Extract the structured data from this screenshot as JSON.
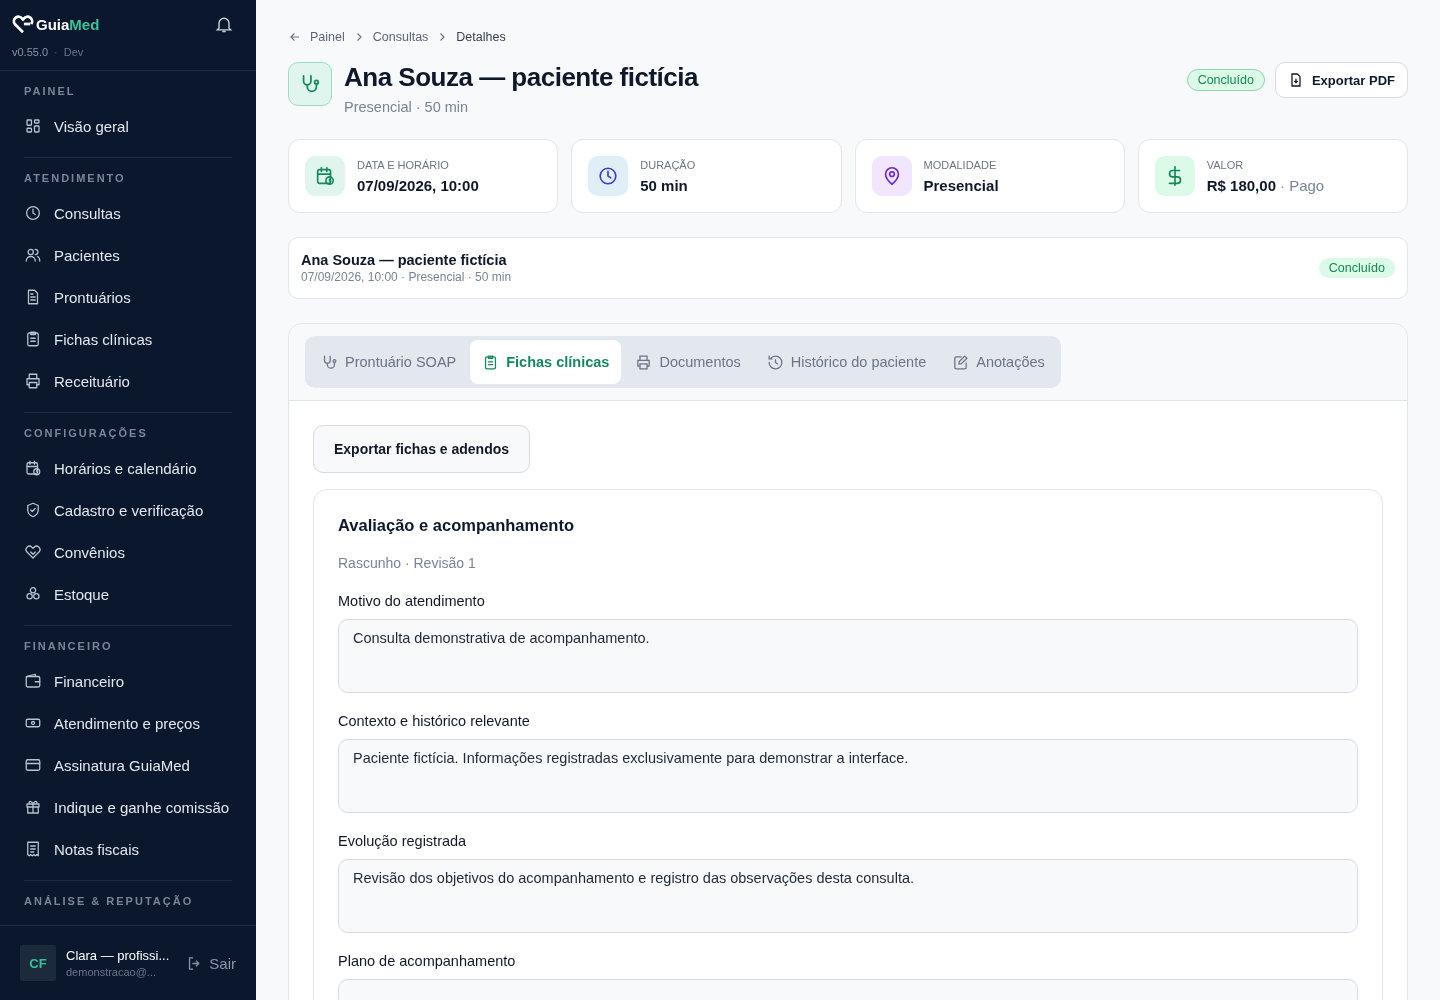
{
  "brand": {
    "name_part1": "Guia",
    "name_part2": "Med",
    "version": "v0.55.0",
    "separator": "·",
    "env": "Dev"
  },
  "sidebar": {
    "sections": [
      {
        "title": "PAINEL",
        "items": [
          {
            "label": "Visão geral"
          }
        ]
      },
      {
        "title": "ATENDIMENTO",
        "items": [
          {
            "label": "Consultas"
          },
          {
            "label": "Pacientes"
          },
          {
            "label": "Prontuários"
          },
          {
            "label": "Fichas clínicas"
          },
          {
            "label": "Receituário"
          }
        ]
      },
      {
        "title": "CONFIGURAÇÕES",
        "items": [
          {
            "label": "Horários e calendário"
          },
          {
            "label": "Cadastro e verificação"
          },
          {
            "label": "Convênios"
          },
          {
            "label": "Estoque"
          }
        ]
      },
      {
        "title": "FINANCEIRO",
        "items": [
          {
            "label": "Financeiro"
          },
          {
            "label": "Atendimento e preços"
          },
          {
            "label": "Assinatura GuiaMed"
          },
          {
            "label": "Indique e ganhe comissão"
          },
          {
            "label": "Notas fiscais"
          }
        ]
      },
      {
        "title": "ANÁLISE & REPUTAÇÃO"
      }
    ],
    "user": {
      "initials": "CF",
      "name": "Clara — profissi...",
      "email": "demonstracao@...",
      "logout": "Sair"
    }
  },
  "breadcrumb": [
    "Painel",
    "Consultas",
    "Detalhes"
  ],
  "header": {
    "title": "Ana Souza — paciente fictícia",
    "subtitle": "Presencial · 50 min",
    "status": "Concluído",
    "export": "Exportar PDF"
  },
  "stats": [
    {
      "label": "DATA E HORÁRIO",
      "value": "07/09/2026, 10:00"
    },
    {
      "label": "DURAÇÃO",
      "value": "50 min"
    },
    {
      "label": "MODALIDADE",
      "value": "Presencial"
    },
    {
      "label": "VALOR",
      "value": "R$ 180,00",
      "note": "· Pago"
    }
  ],
  "summary": {
    "title": "Ana Souza — paciente fictícia",
    "meta": "07/09/2026, 10:00 · Presencial · 50 min",
    "status": "Concluído"
  },
  "tabs": [
    {
      "label": "Prontuário SOAP",
      "selected": false
    },
    {
      "label": "Fichas clínicas",
      "selected": true
    },
    {
      "label": "Documentos",
      "selected": false
    },
    {
      "label": "Histórico do paciente",
      "selected": false
    },
    {
      "label": "Anotações",
      "selected": false
    }
  ],
  "export_button": "Exportar fichas e adendos",
  "form": {
    "title": "Avaliação e acompanhamento",
    "meta": "Rascunho · Revisão 1",
    "fields": [
      {
        "label": "Motivo do atendimento",
        "value": "Consulta demonstrativa de acompanhamento."
      },
      {
        "label": "Contexto e histórico relevante",
        "value": "Paciente fictícia. Informações registradas exclusivamente para demonstrar a interface."
      },
      {
        "label": "Evolução registrada",
        "value": "Revisão dos objetivos do acompanhamento e registro das observações desta consulta."
      },
      {
        "label": "Plano de acompanhamento"
      }
    ]
  }
}
